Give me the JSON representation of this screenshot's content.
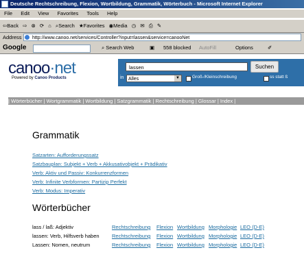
{
  "window": {
    "title": "Deutsche Rechtschreibung, Flexion, Wortbildung, Grammatik, Wörterbuch - Microsoft Internet Explorer"
  },
  "menu": [
    "File",
    "Edit",
    "View",
    "Favorites",
    "Tools",
    "Help"
  ],
  "toolbar": {
    "back": "Back",
    "search": "Search",
    "favorites": "Favorites",
    "media": "Media"
  },
  "address": {
    "label": "Address",
    "url": "http://www.canoo.net/services/Controller?input=lassen&service=canooNet"
  },
  "googlebar": {
    "logo": "Google",
    "search_web": "Search Web",
    "blocked": "558 blocked",
    "autofill": "AutoFill",
    "options": "Options"
  },
  "site": {
    "logo_main": "canoo",
    "logo_net": "net",
    "powered_by": "Powered by",
    "powered_company": "Canoo Products",
    "search_value": "lassen",
    "search_button": "Suchen",
    "in_label": "in",
    "scope_select": "Alles",
    "option_case": "Groß-/Kleinschreibung",
    "option_ss": "ss statt ß"
  },
  "nav": "| Wörterbücher | Wortgrammatik | Wortbildung | Satzgrammatik | Rechtschreibung | Glossar | Index |",
  "grammatik": {
    "heading": "Grammatik",
    "links": [
      "Satzarten: Aufforderungssatz",
      "Satzbauplan: Subjekt + Verb + Akkusativobjekt + Prädikativ",
      "Verb: Aktiv und Passiv: Konkurrenzformen",
      "Verb: Infinite Verbformen: Partizip Perfekt",
      "Verb: Modus: Imperativ"
    ]
  },
  "woerterbuecher": {
    "heading": "Wörterbücher",
    "rows": [
      {
        "term": "lass / laß: Adjektiv",
        "links": [
          "Rechtschreibung",
          "Flexion",
          "Wortbildung",
          "Morphologie",
          "LEO (D-E)"
        ]
      },
      {
        "term": "lassen: Verb, Hilfsverb haben",
        "links": [
          "Rechtschreibung",
          "Flexion",
          "Wortbildung",
          "Morphologie",
          "LEO (D-E)"
        ]
      },
      {
        "term": "Lassen: Nomen, neutrum",
        "links": [
          "Rechtschreibung",
          "Flexion",
          "Wortbildung",
          "Morphologie",
          "LEO (D-E)"
        ]
      }
    ]
  }
}
